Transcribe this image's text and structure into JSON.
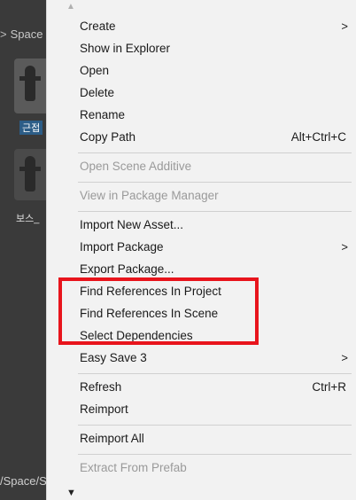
{
  "background_panel": {
    "breadcrumb": "Space",
    "breadcrumb_separator": ">",
    "assets": [
      {
        "label": "근접",
        "selected": true
      },
      {
        "label": "보스_",
        "selected": false
      }
    ],
    "footer_path": "/Space/S"
  },
  "context_menu": {
    "items": [
      {
        "label": "Create",
        "disabled": false,
        "submenu": true
      },
      {
        "label": "Show in Explorer",
        "disabled": false
      },
      {
        "label": "Open",
        "disabled": false
      },
      {
        "label": "Delete",
        "disabled": false
      },
      {
        "label": "Rename",
        "disabled": false
      },
      {
        "label": "Copy Path",
        "disabled": false,
        "shortcut": "Alt+Ctrl+C"
      },
      {
        "label": "Open Scene Additive",
        "disabled": true
      },
      {
        "label": "View in Package Manager",
        "disabled": true
      },
      {
        "label": "Import New Asset...",
        "disabled": false
      },
      {
        "label": "Import Package",
        "disabled": false,
        "submenu": true
      },
      {
        "label": "Export Package...",
        "disabled": false
      },
      {
        "label": "Find References In Project",
        "disabled": false
      },
      {
        "label": "Find References In Scene",
        "disabled": false
      },
      {
        "label": "Select Dependencies",
        "disabled": false
      },
      {
        "label": "Easy Save 3",
        "disabled": false,
        "submenu": true
      },
      {
        "label": "Refresh",
        "disabled": false,
        "shortcut": "Ctrl+R"
      },
      {
        "label": "Reimport",
        "disabled": false
      },
      {
        "label": "Reimport All",
        "disabled": false
      },
      {
        "label": "Extract From Prefab",
        "disabled": true
      }
    ],
    "submenu_arrow": ">",
    "scroll_up": "▲",
    "scroll_down": "▼"
  },
  "colors": {
    "highlight_box": "#e8141c",
    "selected_asset": "#2c5d87",
    "menu_background": "#f2f2f2",
    "disabled_text": "#9a9a9a"
  }
}
